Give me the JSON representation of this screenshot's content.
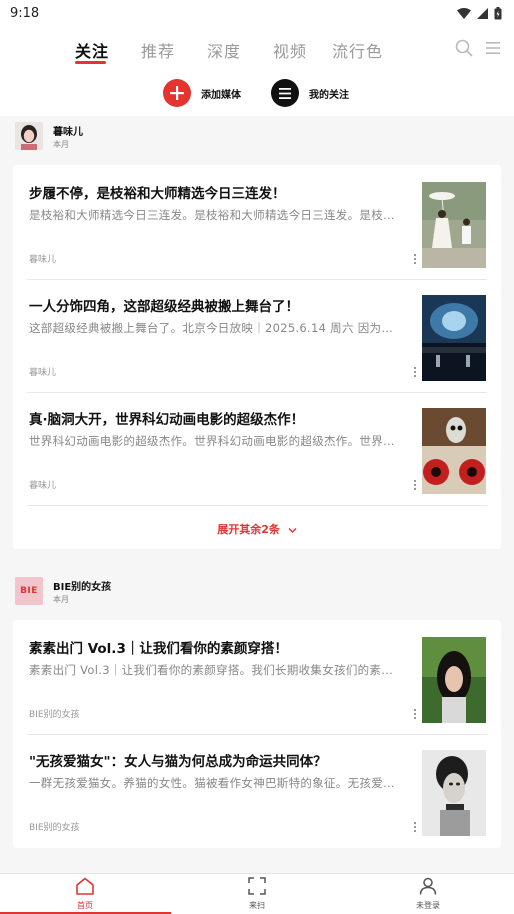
{
  "status_bar": {
    "time": "9:18"
  },
  "tabs": [
    {
      "label": "关注",
      "active": true
    },
    {
      "label": "推荐",
      "active": false
    },
    {
      "label": "深度",
      "active": false
    },
    {
      "label": "视频",
      "active": false
    },
    {
      "label": "流行色",
      "active": false
    }
  ],
  "actions": {
    "add_media_label": "添加媒体",
    "my_follow_label": "我的关注"
  },
  "groups": [
    {
      "source_name": "暮味儿",
      "time": "本月",
      "articles": [
        {
          "title": "步履不停，是枝裕和大师精选今日三连发！",
          "desc": "是枝裕和大师精选今日三连发。是枝裕和大师精选今日三连发。是枝裕和大师精选今日三连发。",
          "source": "暮味儿"
        },
        {
          "title": "一人分饰四角，这部超级经典被搬上舞台了！",
          "desc": "这部超级经典被搬上舞台了。北京今日放映｜2025.6.14 周六 因为这部超级经典",
          "source": "暮味儿"
        },
        {
          "title": "真·脑洞大开，世界科幻动画电影的超级杰作！",
          "desc": "世界科幻动画电影的超级杰作。世界科幻动画电影的超级杰作。世界科幻动画电影",
          "source": "暮味儿"
        }
      ],
      "expand_label": "展开其余2条"
    },
    {
      "source_name": "BIE别的女孩",
      "time": "本月",
      "avatar_text": "BIE",
      "articles": [
        {
          "title": "素素出门 Vol.3｜让我们看你的素颜穿搭！",
          "desc": "素素出门 Vol.3｜让我们看你的素颜穿搭。我们长期收集女孩们的素颜穿搭",
          "source": "BIE别的女孩"
        },
        {
          "title": "\"无孩爱猫女\"：女人与猫为何总成为命运共同体？",
          "desc": "一群无孩爱猫女。养猫的女性。猫被看作女神巴斯特的象征。无孩爱猫女",
          "source": "BIE别的女孩"
        }
      ]
    }
  ],
  "bottom_nav": [
    {
      "label": "首页",
      "icon": "home-icon",
      "active": true
    },
    {
      "label": "来扫",
      "icon": "scan-icon",
      "active": false
    },
    {
      "label": "未登录",
      "icon": "user-icon",
      "active": false
    }
  ],
  "colors": {
    "accent": "#e3342f",
    "add_button": "#e3342f",
    "follow_button": "#111111"
  }
}
